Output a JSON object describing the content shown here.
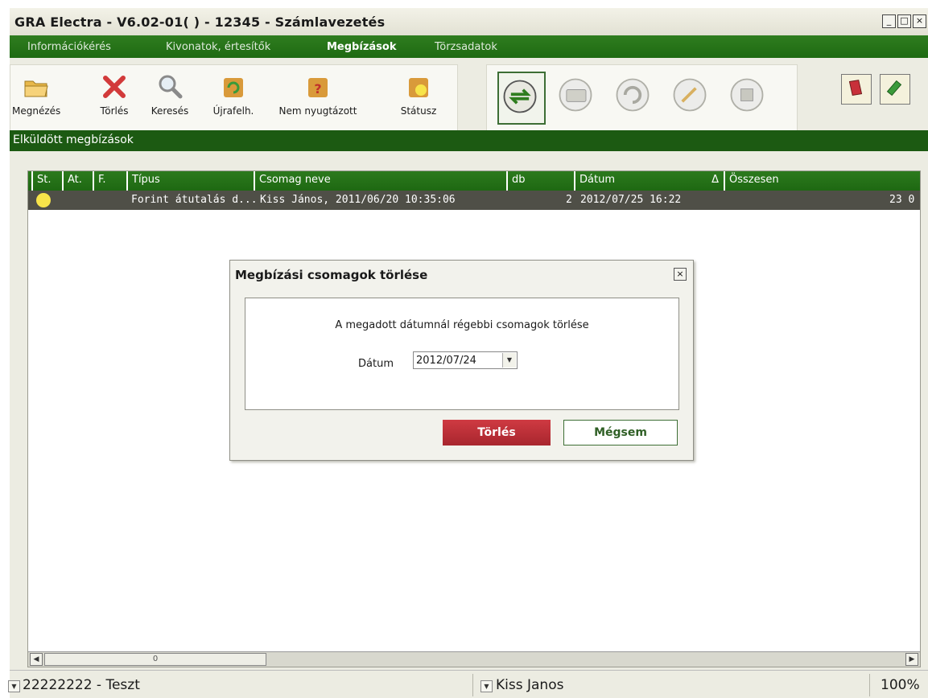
{
  "window": {
    "title": "GRA Electra - V6.02-01( ) - 12345 - Számlavezetés",
    "minimize": "_",
    "maximize": "□",
    "close": "×"
  },
  "menu": {
    "items": [
      "Információkérés",
      "Kivonatok, értesítők",
      "Megbízások",
      "Törzsadatok"
    ],
    "active_index": 2
  },
  "toolbar": {
    "buttons": [
      {
        "label": "Megnézés",
        "icon": "folder-icon"
      },
      {
        "label": "Törlés",
        "icon": "delete-x-icon"
      },
      {
        "label": "Keresés",
        "icon": "magnifier-icon"
      },
      {
        "label": "Újrafelh.",
        "icon": "recycle-box-icon"
      },
      {
        "label": "Nem nyugtázott",
        "icon": "question-box-icon"
      },
      {
        "label": "Státusz",
        "icon": "status-box-icon"
      }
    ],
    "big_icons": [
      "transfer-icon",
      "card-icon",
      "refresh-icon",
      "sign-icon",
      "package-icon"
    ],
    "right_icons": [
      "red-book-icon",
      "green-book-icon"
    ]
  },
  "section": {
    "title": "Elküldött megbízások"
  },
  "grid": {
    "columns": [
      "St.",
      "At.",
      "F.",
      "Típus",
      "Csomag neve",
      "db",
      "Dátum",
      "Összesen"
    ],
    "sort_indicator": "Δ",
    "rows": [
      {
        "status": "yellow",
        "tipus": "Forint átutalás d...",
        "csomag_neve": "Kiss János, 2011/06/20 10:35:06",
        "db": "2",
        "datum": "2012/07/25  16:22",
        "osszesen": "23 0"
      }
    ],
    "scroll_thumb": "0"
  },
  "statusbar": {
    "account": "22222222 - Teszt",
    "user": "Kiss Janos",
    "zoom": "100%"
  },
  "dialog": {
    "title": "Megbízási csomagok törlése",
    "close": "×",
    "message": "A megadott dátumnál régebbi csomagok törlése",
    "date_label": "Dátum",
    "date_value": "2012/07/24",
    "delete_button": "Törlés",
    "cancel_button": "Mégsem"
  },
  "colors": {
    "menu_green": "#1e6a12",
    "section_green": "#1c5a12",
    "row_dark": "#4f4f47",
    "status_yellow": "#f7e44a",
    "delete_red": "#b8303a"
  }
}
